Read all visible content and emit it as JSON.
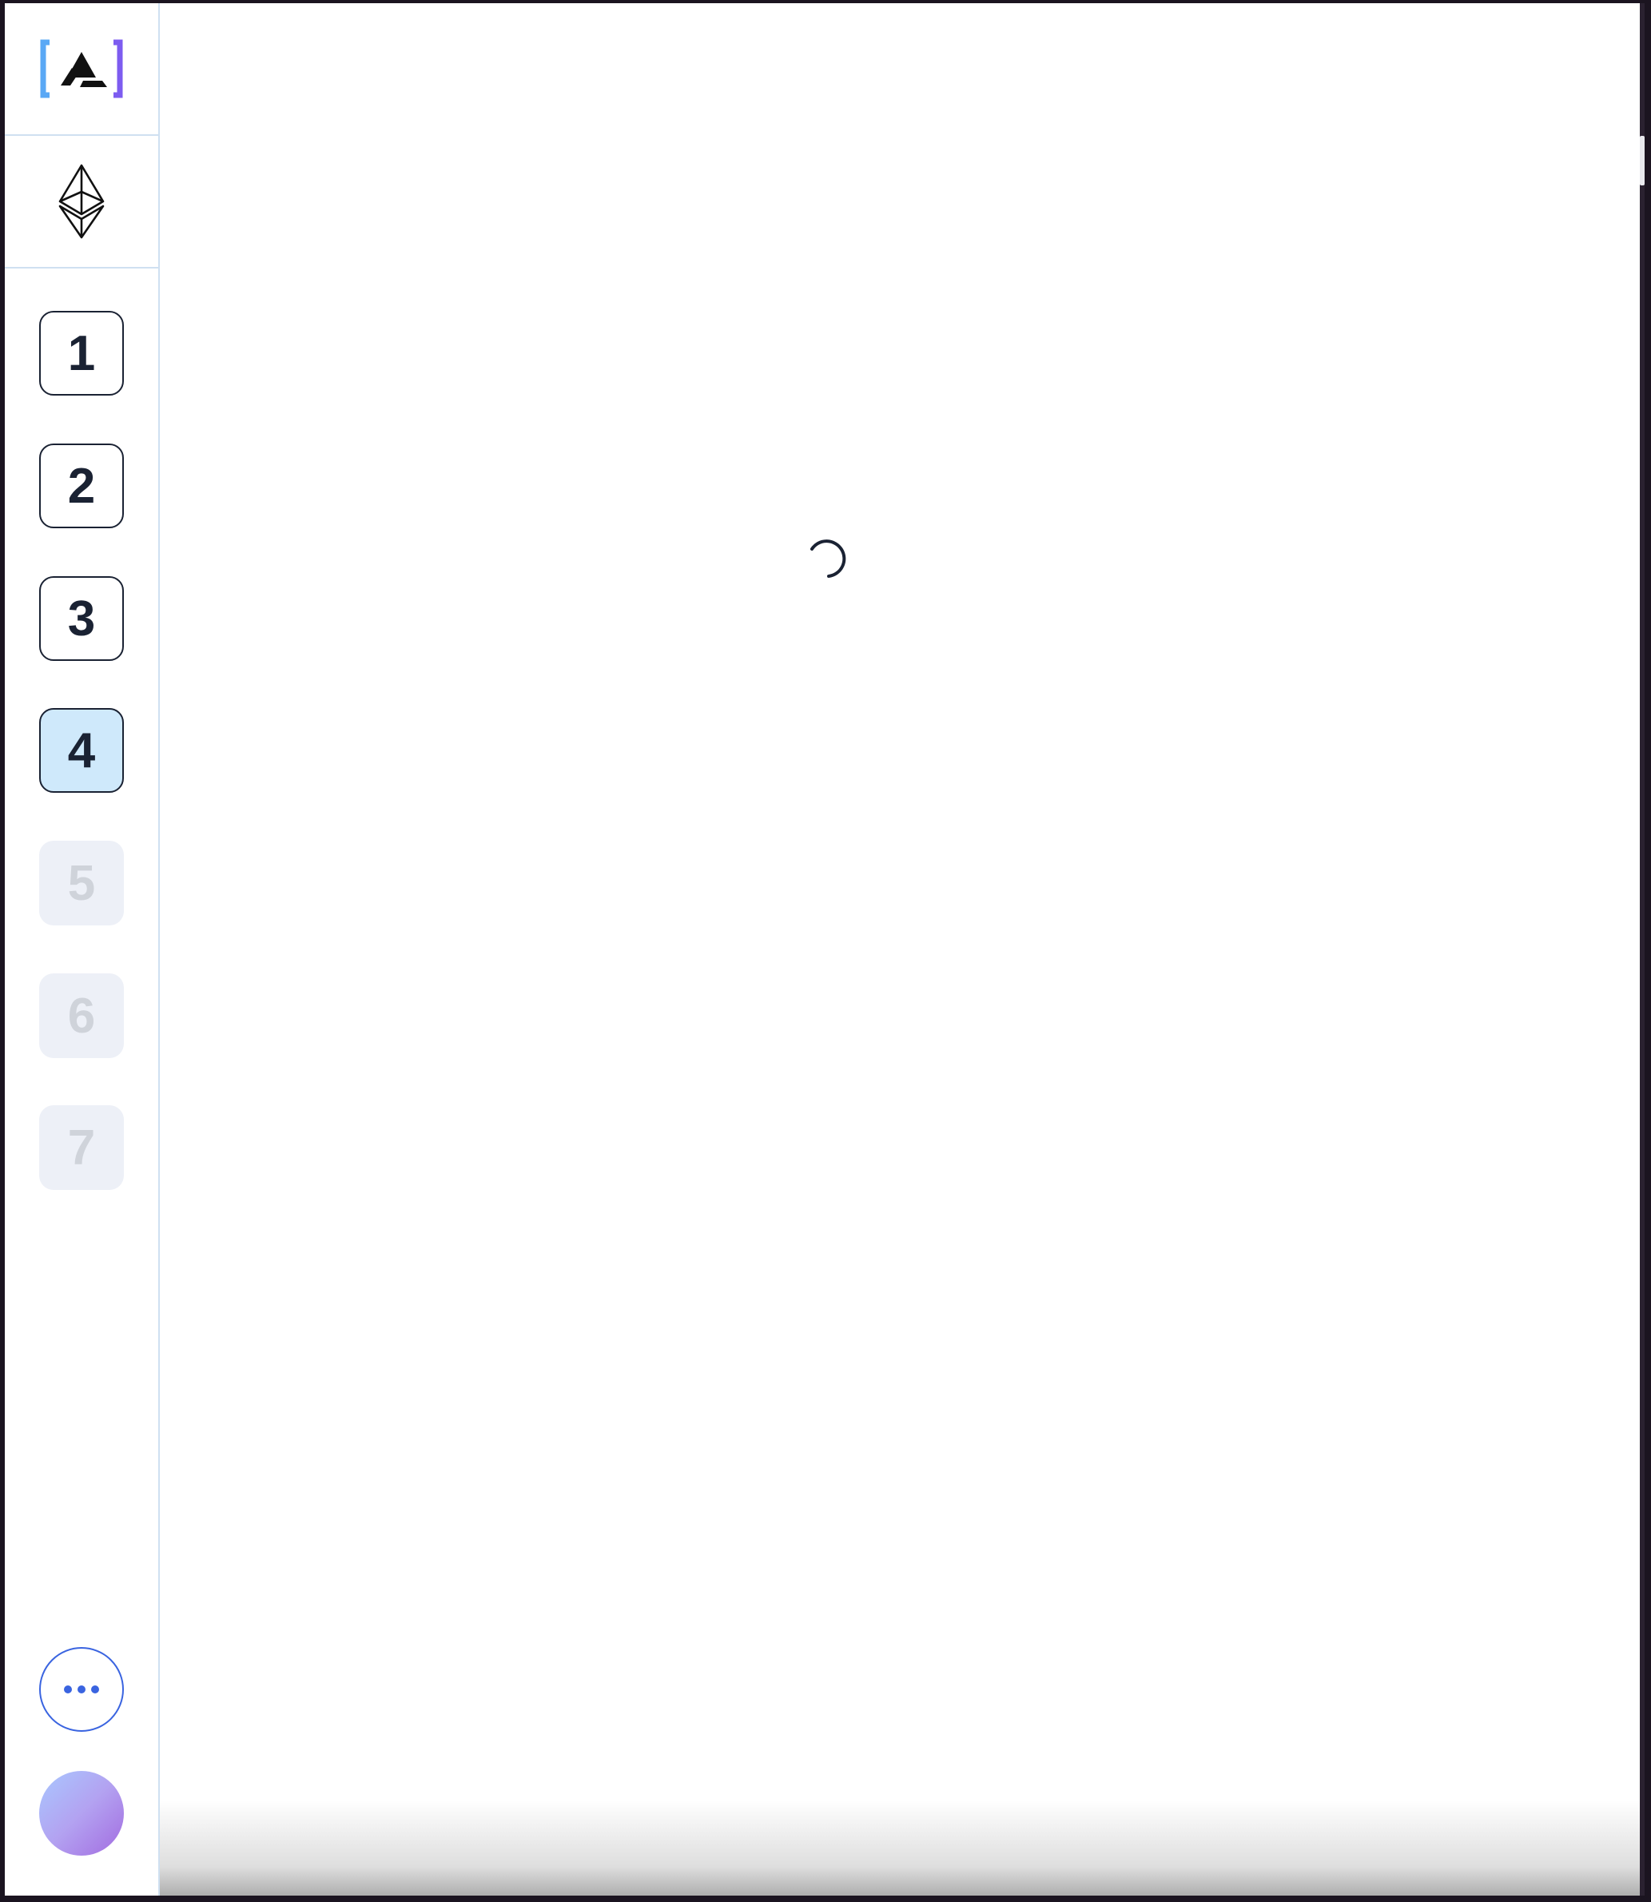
{
  "logo": {
    "icon": "bracketed-a-logo-icon",
    "bracket_left_color": "#5aa8f5",
    "bracket_right_color": "#7d5cf0"
  },
  "network": {
    "icon": "ethereum-icon"
  },
  "steps": [
    {
      "label": "1",
      "state": "default"
    },
    {
      "label": "2",
      "state": "default"
    },
    {
      "label": "3",
      "state": "default"
    },
    {
      "label": "4",
      "state": "active"
    },
    {
      "label": "5",
      "state": "disabled"
    },
    {
      "label": "6",
      "state": "disabled"
    },
    {
      "label": "7",
      "state": "disabled"
    }
  ],
  "more_button": {
    "icon": "more-dots-icon",
    "color": "#3a64e0"
  },
  "avatar": {
    "gradient": [
      "#a9c8ff",
      "#a26be0"
    ]
  },
  "main": {
    "status": "loading",
    "spinner_icon": "loading-spinner-icon"
  },
  "colors": {
    "active_step_bg": "#cfe9fb",
    "disabled_step_bg": "#edf0f7",
    "divider": "#cfe0f1"
  }
}
